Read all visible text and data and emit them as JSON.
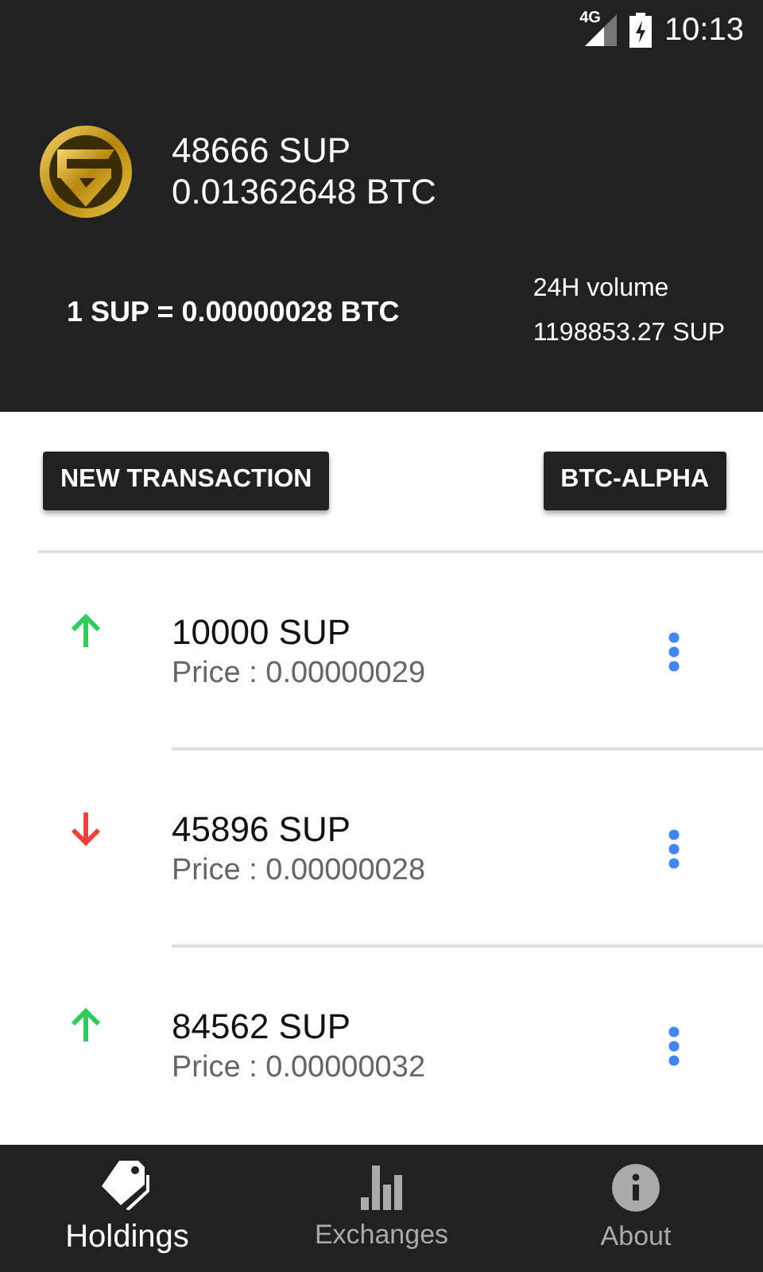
{
  "status_bar": {
    "network": "4G",
    "time": "10:13"
  },
  "header": {
    "balance": "48666 SUP",
    "balance_btc": "0.01362648 BTC",
    "rate": "1 SUP = 0.00000028 BTC",
    "volume_label": "24H volume",
    "volume": "1198853.27 SUP"
  },
  "actions": [
    "NEW TRANSACTION",
    "BTC-ALPHA"
  ],
  "transactions": [
    {
      "kind": "up",
      "amount": "10000 SUP",
      "price": "Price : 0.00000029"
    },
    {
      "kind": "down",
      "amount": "45896 SUP",
      "price": "Price : 0.00000028"
    },
    {
      "kind": "up",
      "amount": "84562 SUP",
      "price": "Price : 0.00000032"
    }
  ],
  "nav": [
    {
      "kind": "tags",
      "label": "Holdings",
      "selected": true
    },
    {
      "kind": "chart",
      "label": "Exchanges",
      "selected": false
    },
    {
      "kind": "info",
      "label": "About",
      "selected": false
    }
  ]
}
